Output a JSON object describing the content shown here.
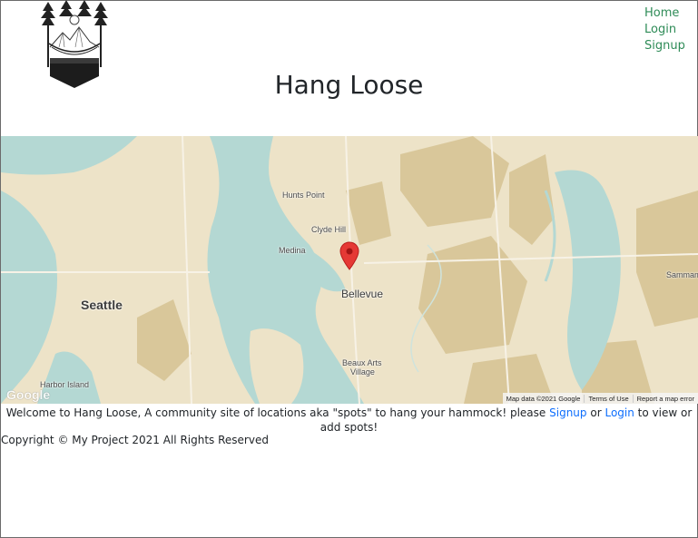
{
  "site": {
    "title": "Hang Loose"
  },
  "nav": {
    "items": [
      {
        "label": "Home"
      },
      {
        "label": "Login"
      },
      {
        "label": "Signup"
      }
    ]
  },
  "map": {
    "labels": {
      "hunts_point": "Hunts Point",
      "clyde_hill": "Clyde Hill",
      "medina": "Medina",
      "seattle": "Seattle",
      "bellevue": "Bellevue",
      "harbor_island": "Harbor Island",
      "beaux_arts": "Beaux Arts",
      "village": "Village",
      "sammamish": "Sammam"
    },
    "provider": "Google",
    "attribution": {
      "map_data": "Map data ©2021 Google",
      "terms": "Terms of Use",
      "report": "Report a map error"
    },
    "colors": {
      "land": "#ede3c8",
      "water": "#b4d8d3",
      "park": "#d8c89a",
      "marker": "#e53935"
    }
  },
  "welcome": {
    "prefix": "Welcome to Hang Loose, A community site of locations aka \"spots\" to hang your hammock! please",
    "signup": "Signup",
    "or": "or",
    "login": "Login",
    "suffix": "to view or add spots!"
  },
  "footer": {
    "copyright": "Copyright © My Project 2021 All Rights Reserved"
  }
}
